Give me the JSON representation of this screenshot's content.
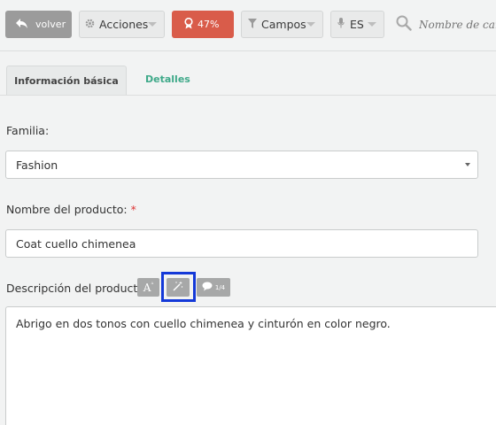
{
  "toolbar": {
    "back_label": "volver",
    "actions_label": "Acciones",
    "score_label": "47%",
    "fields_label": "Campos",
    "language_label": "ES",
    "search_placeholder": "Nombre de campo"
  },
  "tabs": [
    {
      "label": "Información básica",
      "active": true
    },
    {
      "label": "Detalles",
      "active": false
    }
  ],
  "form": {
    "family_label": "Familia:",
    "family_value": "Fashion",
    "product_name_label": "Nombre del producto:",
    "required_mark": "*",
    "product_name_value": "Coat cuello chimenea",
    "description_label": "Descripción del producto:",
    "description_value": "Abrigo en dos tonos con cuello chimenea y cinturón en color negro.",
    "tools": {
      "font_tool_glyph": "A",
      "comment_count": "1/4"
    }
  },
  "colors": {
    "back_button": "#9b9b9b",
    "score_badge": "#d95c4a",
    "active_tab_text": "#444444",
    "inactive_tab_text": "#3fa989",
    "highlight_box": "#1439d8"
  },
  "icons": [
    "arrow-back-icon",
    "gear-icon",
    "award-icon",
    "filter-icon",
    "microphone-icon",
    "search-icon",
    "magic-wand-icon",
    "comment-icon"
  ]
}
